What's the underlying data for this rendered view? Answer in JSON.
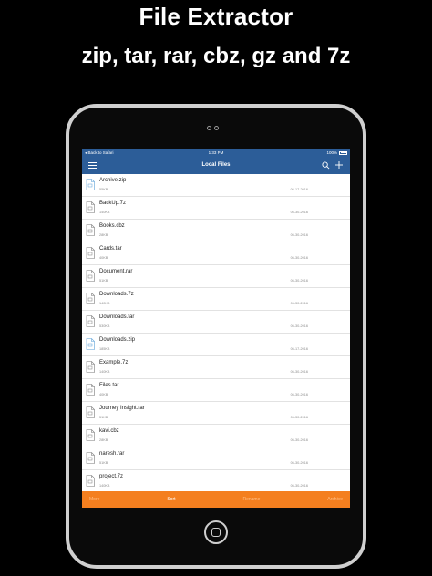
{
  "promo": {
    "title": "File Extractor",
    "subtitle": "zip, tar, rar, cbz, gz and 7z"
  },
  "status_bar": {
    "back_label": "◂ Back to Safari",
    "time": "1:33 PM",
    "battery": "100%"
  },
  "nav": {
    "title": "Local Files",
    "menu_icon": "hamburger-menu-icon",
    "search_icon": "search-icon",
    "add_icon": "plus-icon"
  },
  "files": [
    {
      "name": "Archive.zip",
      "size": "55KB",
      "date": "06-17-2016",
      "type": "zip"
    },
    {
      "name": "BackUp.7z",
      "size": "140KB",
      "date": "06-30-2016",
      "type": "7z"
    },
    {
      "name": "Books.cbz",
      "size": "28KB",
      "date": "06-30-2016",
      "type": "cbz"
    },
    {
      "name": "Cards.tar",
      "size": "40KB",
      "date": "06-30-2016",
      "type": "tar"
    },
    {
      "name": "Document.rar",
      "size": "51KB",
      "date": "06-30-2016",
      "type": "rar"
    },
    {
      "name": "Downloads.7z",
      "size": "140KB",
      "date": "06-30-2016",
      "type": "7z"
    },
    {
      "name": "Downloads.tar",
      "size": "530KB",
      "date": "06-30-2016",
      "type": "tar"
    },
    {
      "name": "Downloads.zip",
      "size": "185KB",
      "date": "06-17-2016",
      "type": "zip"
    },
    {
      "name": "Example.7z",
      "size": "140KB",
      "date": "06-30-2016",
      "type": "7z"
    },
    {
      "name": "Files.tar",
      "size": "40KB",
      "date": "06-30-2016",
      "type": "tar"
    },
    {
      "name": "Journey Insight.rar",
      "size": "51KB",
      "date": "06-30-2016",
      "type": "rar"
    },
    {
      "name": "kavi.cbz",
      "size": "28KB",
      "date": "06-30-2016",
      "type": "cbz"
    },
    {
      "name": "naresh.rar",
      "size": "51KB",
      "date": "06-30-2016",
      "type": "rar"
    },
    {
      "name": "project.7z",
      "size": "140KB",
      "date": "06-30-2016",
      "type": "7z"
    }
  ],
  "bottom_bar": {
    "more": "More",
    "sort": "Sort",
    "rename": "Rename",
    "archive": "Archive"
  },
  "colors": {
    "nav_blue": "#2c5d98",
    "bottom_orange": "#f47f1f",
    "zip_icon_blue": "#5aa0d8",
    "file_icon_gray": "#7a7a7a"
  }
}
